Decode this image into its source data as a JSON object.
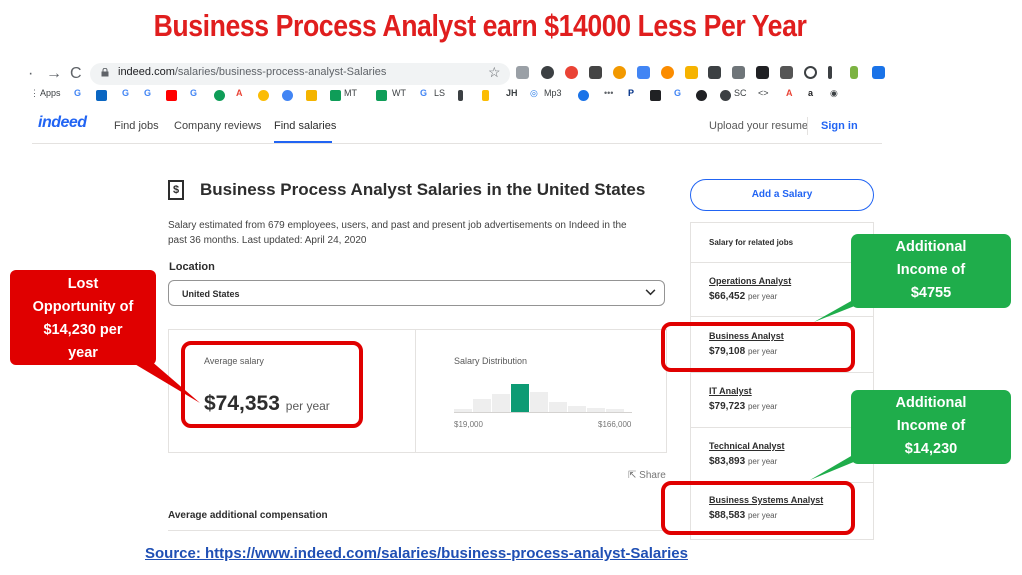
{
  "headline": "Business Process Analyst earn $14000 Less Per Year",
  "browser": {
    "url_host": "indeed.com",
    "url_path": "/salaries/business-process-analyst-Salaries",
    "bookmarks": [
      "Apps",
      "MT",
      "WT",
      "LS",
      "Mp3",
      "SC"
    ]
  },
  "nav": {
    "logo": "indeed",
    "find_jobs": "Find jobs",
    "company_reviews": "Company reviews",
    "find_salaries": "Find salaries",
    "upload_resume": "Upload your resume",
    "sign_in": "Sign in"
  },
  "main": {
    "icon_glyph": "$",
    "title": "Business Process Analyst Salaries in the United States",
    "description": "Salary estimated from 679 employees, users, and past and present job advertisements on Indeed in the past 36 months. Last updated: April 24, 2020",
    "location_label": "Location",
    "location_value": "United States",
    "avg_label": "Average salary",
    "avg_value": "$74,353",
    "avg_unit": "per year",
    "dist_label": "Salary Distribution",
    "dist_min": "$19,000",
    "dist_max": "$166,000",
    "distribution": [
      0.1,
      0.45,
      0.65,
      1.0,
      0.7,
      0.35,
      0.2,
      0.15,
      0.1
    ],
    "highlight_bin": 3,
    "share": "Share",
    "additional_comp": "Average additional compensation"
  },
  "sidebar": {
    "add_salary": "Add a Salary",
    "heading": "Salary for related jobs",
    "jobs": [
      {
        "title": "Operations Analyst",
        "pay": "$66,452",
        "unit": "per year"
      },
      {
        "title": "Business Analyst",
        "pay": "$79,108",
        "unit": "per year"
      },
      {
        "title": "IT Analyst",
        "pay": "$79,723",
        "unit": "per year"
      },
      {
        "title": "Technical Analyst",
        "pay": "$83,893",
        "unit": "per year"
      },
      {
        "title": "Business Systems Analyst",
        "pay": "$88,583",
        "unit": "per year"
      }
    ]
  },
  "annotations": {
    "lost": [
      "Lost",
      "Opportunity of",
      "$14,230 per",
      "year"
    ],
    "gain1": [
      "Additional",
      "Income of",
      "$4755"
    ],
    "gain2": [
      "Additional",
      "Income of",
      "$14,230"
    ]
  },
  "source": "Source:  https://www.indeed.com/salaries/business-process-analyst-Salaries",
  "colors": {
    "accent_blue": "#2164f3",
    "highlight_green": "#0d9b74",
    "alert_red": "#e00000",
    "callout_green": "#1fad4b"
  }
}
